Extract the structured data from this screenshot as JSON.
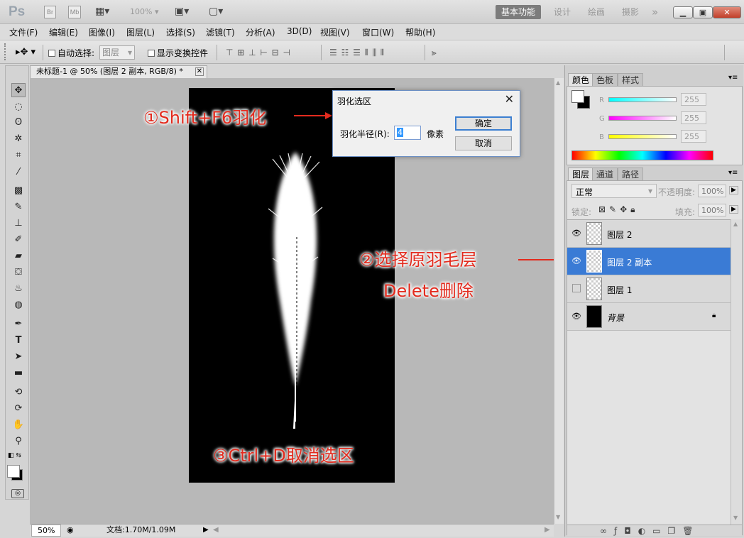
{
  "app": {
    "logo": "Ps",
    "bridge": "Br",
    "minibridge": "Mb",
    "zoom_value": "100%",
    "workspaces": [
      "基本功能",
      "设计",
      "绘画",
      "摄影"
    ],
    "more": "»"
  },
  "menu": [
    "文件(F)",
    "编辑(E)",
    "图像(I)",
    "图层(L)",
    "选择(S)",
    "滤镜(T)",
    "分析(A)",
    "3D(D)",
    "视图(V)",
    "窗口(W)",
    "帮助(H)"
  ],
  "options": {
    "auto_select_label": "自动选择:",
    "auto_select_value": "图层",
    "show_transform_label": "显示变换控件"
  },
  "document": {
    "tab_title": "未标题-1 @ 50% (图层 2 副本, RGB/8) *",
    "zoom": "50%",
    "doc_info": "文档:1.70M/1.09M"
  },
  "annotations": {
    "step1": "①Shift+F6羽化",
    "step2_line1": "②选择原羽毛层",
    "step2_line2": "Delete删除",
    "step3": "③Ctrl+D取消选区"
  },
  "dialog": {
    "title": "羽化选区",
    "radius_label": "羽化半径(R):",
    "radius_value": "4",
    "unit": "像素",
    "ok": "确定",
    "cancel": "取消"
  },
  "color_panel": {
    "tabs": [
      "颜色",
      "色板",
      "样式"
    ],
    "channels": [
      {
        "label": "R",
        "value": "255"
      },
      {
        "label": "G",
        "value": "255"
      },
      {
        "label": "B",
        "value": "255"
      }
    ]
  },
  "layers_panel": {
    "tabs": [
      "图层",
      "通道",
      "路径"
    ],
    "blend_mode": "正常",
    "opacity_label": "不透明度:",
    "opacity_value": "100%",
    "lock_label": "锁定:",
    "fill_label": "填充:",
    "fill_value": "100%",
    "layers": [
      {
        "name": "图层 2",
        "visible": true,
        "selected": false
      },
      {
        "name": "图层 2 副本",
        "visible": true,
        "selected": true
      },
      {
        "name": "图层 1",
        "visible": false,
        "selected": false
      },
      {
        "name": "背景",
        "visible": true,
        "selected": false
      }
    ]
  },
  "colors": {
    "selection_blue": "#3a7bd5",
    "annotation_red": "#e32b1e"
  }
}
